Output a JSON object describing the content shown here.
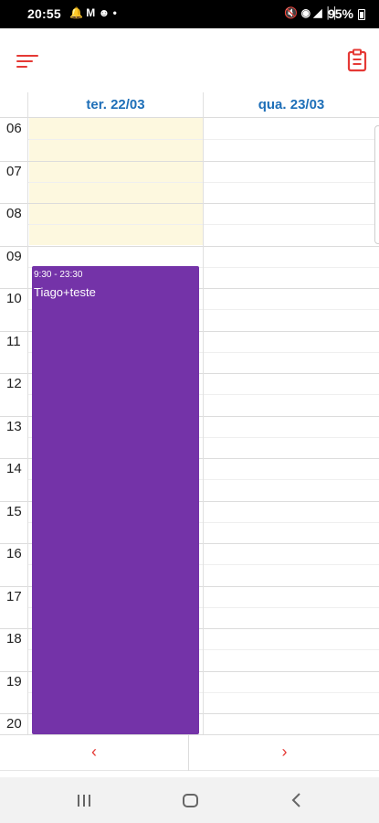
{
  "status_bar": {
    "time": "20:55",
    "left_icons": "🔔 M ☻ •",
    "right_icons": "🔇 ◉ ◢ ││",
    "battery": "95%"
  },
  "calendar": {
    "days": [
      {
        "label": "ter. 22/03"
      },
      {
        "label": "qua. 23/03"
      }
    ],
    "hours": [
      "06",
      "07",
      "08",
      "09",
      "10",
      "11",
      "12",
      "13",
      "14",
      "15",
      "16",
      "17",
      "18",
      "19",
      "20"
    ],
    "event": {
      "time": "9:30 - 23:30",
      "title": "Tiago+teste",
      "color": "#7433a8"
    }
  },
  "pager": {
    "prev": "‹",
    "next": "›"
  },
  "colors": {
    "accent": "#e53935",
    "day_header": "#1e6fb8",
    "today_highlight": "#fdf8df"
  }
}
